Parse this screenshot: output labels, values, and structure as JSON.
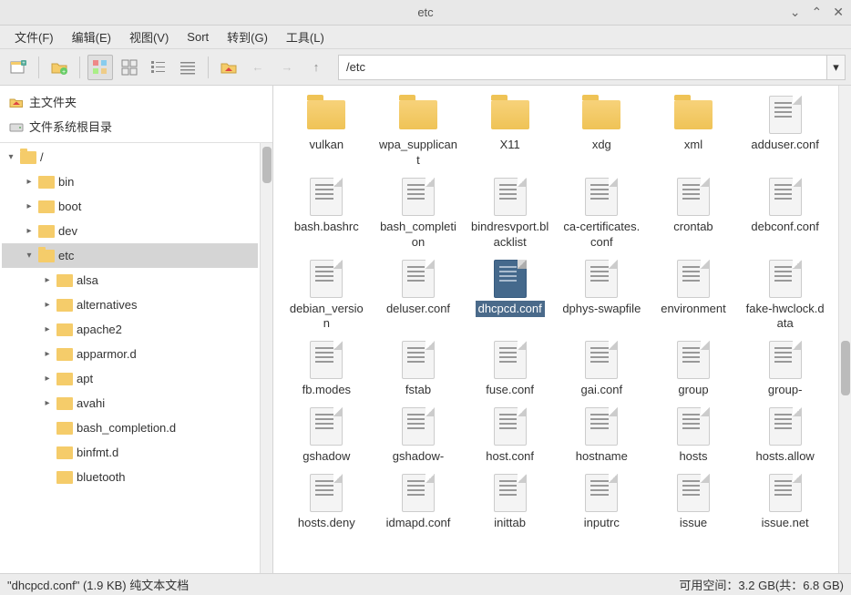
{
  "window": {
    "title": "etc"
  },
  "menubar": [
    {
      "label": "文件(F)"
    },
    {
      "label": "编辑(E)"
    },
    {
      "label": "视图(V)"
    },
    {
      "label": "Sort"
    },
    {
      "label": "转到(G)"
    },
    {
      "label": "工具(L)"
    }
  ],
  "path": "/etc",
  "places": {
    "home": "主文件夹",
    "filesystem": "文件系统根目录"
  },
  "tree": {
    "root": "/",
    "items": [
      {
        "label": "bin",
        "depth": 1,
        "expander": "▸"
      },
      {
        "label": "boot",
        "depth": 1,
        "expander": "▸"
      },
      {
        "label": "dev",
        "depth": 1,
        "expander": "▸"
      },
      {
        "label": "etc",
        "depth": 1,
        "expander": "▾",
        "selected": true,
        "open": true
      },
      {
        "label": "alsa",
        "depth": 2,
        "expander": "▸"
      },
      {
        "label": "alternatives",
        "depth": 2,
        "expander": "▸"
      },
      {
        "label": "apache2",
        "depth": 2,
        "expander": "▸"
      },
      {
        "label": "apparmor.d",
        "depth": 2,
        "expander": "▸"
      },
      {
        "label": "apt",
        "depth": 2,
        "expander": "▸"
      },
      {
        "label": "avahi",
        "depth": 2,
        "expander": "▸"
      },
      {
        "label": "bash_completion.d",
        "depth": 2,
        "expander": ""
      },
      {
        "label": "binfmt.d",
        "depth": 2,
        "expander": ""
      },
      {
        "label": "bluetooth",
        "depth": 2,
        "expander": ""
      }
    ]
  },
  "grid": [
    {
      "label": "vulkan",
      "type": "folder"
    },
    {
      "label": "wpa_supplicant",
      "type": "folder"
    },
    {
      "label": "X11",
      "type": "folder"
    },
    {
      "label": "xdg",
      "type": "folder"
    },
    {
      "label": "xml",
      "type": "folder"
    },
    {
      "label": "adduser.conf",
      "type": "file"
    },
    {
      "label": "bash.bashrc",
      "type": "file"
    },
    {
      "label": "bash_completion",
      "type": "file"
    },
    {
      "label": "bindresvport.blacklist",
      "type": "file"
    },
    {
      "label": "ca-certificates.conf",
      "type": "file"
    },
    {
      "label": "crontab",
      "type": "file"
    },
    {
      "label": "debconf.conf",
      "type": "file"
    },
    {
      "label": "debian_version",
      "type": "file"
    },
    {
      "label": "deluser.conf",
      "type": "file"
    },
    {
      "label": "dhcpcd.conf",
      "type": "file",
      "selected": true
    },
    {
      "label": "dphys-swapfile",
      "type": "file"
    },
    {
      "label": "environment",
      "type": "file"
    },
    {
      "label": "fake-hwclock.data",
      "type": "file"
    },
    {
      "label": "fb.modes",
      "type": "file"
    },
    {
      "label": "fstab",
      "type": "file"
    },
    {
      "label": "fuse.conf",
      "type": "file"
    },
    {
      "label": "gai.conf",
      "type": "file"
    },
    {
      "label": "group",
      "type": "file"
    },
    {
      "label": "group-",
      "type": "file"
    },
    {
      "label": "gshadow",
      "type": "file"
    },
    {
      "label": "gshadow-",
      "type": "file"
    },
    {
      "label": "host.conf",
      "type": "file"
    },
    {
      "label": "hostname",
      "type": "file"
    },
    {
      "label": "hosts",
      "type": "file"
    },
    {
      "label": "hosts.allow",
      "type": "file"
    },
    {
      "label": "hosts.deny",
      "type": "file"
    },
    {
      "label": "idmapd.conf",
      "type": "file"
    },
    {
      "label": "inittab",
      "type": "file"
    },
    {
      "label": "inputrc",
      "type": "file"
    },
    {
      "label": "issue",
      "type": "file"
    },
    {
      "label": "issue.net",
      "type": "file"
    }
  ],
  "status": {
    "left": "\"dhcpcd.conf\" (1.9 KB) 纯文本文档",
    "right": "可用空间：3.2 GB(共：6.8 GB)"
  }
}
